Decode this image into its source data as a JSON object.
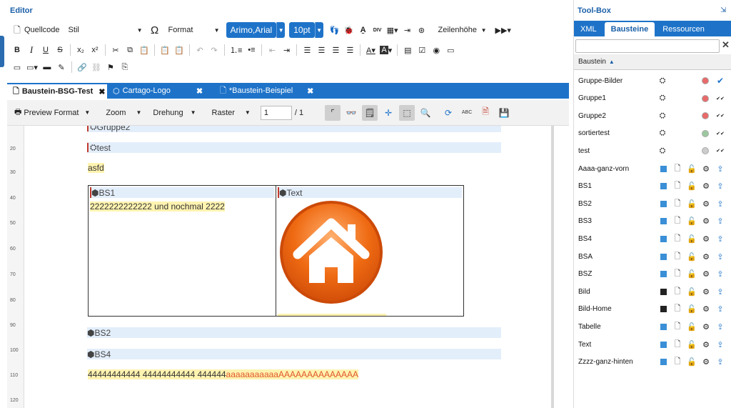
{
  "editor": {
    "title": "Editor",
    "toolbar1": {
      "source": "Quellcode",
      "style": "Stil",
      "format": "Format",
      "font": "Arimo,Arial",
      "size": "10pt",
      "rowheight": "Zeilenhöhe"
    },
    "tabs": [
      {
        "label": "Baustein-BSG-Test"
      },
      {
        "label": "Cartago-Logo"
      },
      {
        "label": "*Baustein-Beispiel"
      }
    ],
    "tab_close": "✖",
    "viewbar": {
      "preview": "Preview Format",
      "zoom": "Zoom",
      "rotation": "Drehung",
      "grid": "Raster",
      "page": "1",
      "pages": "/ 1"
    },
    "ruler": [
      "20",
      "30",
      "40",
      "50",
      "60",
      "70",
      "80",
      "90",
      "100",
      "110",
      "120"
    ],
    "doc": {
      "band_top": "Gruppe2",
      "band_test": "test",
      "asfd": "asfd",
      "cell1_head": "BS1",
      "cell2_head": "Text",
      "cell1_text": "2222222222222 und nochmal 2222",
      "band_bs2": "BS2",
      "band_bs4": "BS4",
      "line_a": "44444444444 44444444444 444444",
      "line_b": "aaaaaaaaaaa",
      "line_c": "AAAAAAAAAAAAAA"
    }
  },
  "toolbox": {
    "title": "Tool-Box",
    "tabs": [
      "XML",
      "Bausteine",
      "Ressourcen"
    ],
    "column": "Baustein",
    "rows": [
      {
        "name": "Gruppe-Bilder",
        "kind": "group",
        "dot": "#e86a6a",
        "check": "single-blue"
      },
      {
        "name": "Gruppe1",
        "kind": "group",
        "dot": "#e86a6a",
        "check": "double"
      },
      {
        "name": "Gruppe2",
        "kind": "group",
        "dot": "#e86a6a",
        "check": "double"
      },
      {
        "name": "sortiertest",
        "kind": "group",
        "dot": "#9cc8a0",
        "check": "double"
      },
      {
        "name": "test",
        "kind": "group",
        "dot": "#cccccc",
        "check": "double"
      },
      {
        "name": "Aaaa-ganz-vorn",
        "kind": "item",
        "color": "#3a8fd6"
      },
      {
        "name": "BS1",
        "kind": "item",
        "color": "#3a8fd6"
      },
      {
        "name": "BS2",
        "kind": "item",
        "color": "#3a8fd6"
      },
      {
        "name": "BS3",
        "kind": "item",
        "color": "#3a8fd6"
      },
      {
        "name": "BS4",
        "kind": "item",
        "color": "#3a8fd6"
      },
      {
        "name": "BSA",
        "kind": "item",
        "color": "#3a8fd6"
      },
      {
        "name": "BSZ",
        "kind": "item",
        "color": "#3a8fd6"
      },
      {
        "name": "Bild",
        "kind": "item",
        "color": "#222222"
      },
      {
        "name": "Bild-Home",
        "kind": "item",
        "color": "#222222"
      },
      {
        "name": "Tabelle",
        "kind": "item",
        "color": "#3a8fd6"
      },
      {
        "name": "Text",
        "kind": "item",
        "color": "#3a8fd6"
      },
      {
        "name": "Zzzz-ganz-hinten",
        "kind": "item",
        "color": "#3a8fd6"
      }
    ]
  }
}
